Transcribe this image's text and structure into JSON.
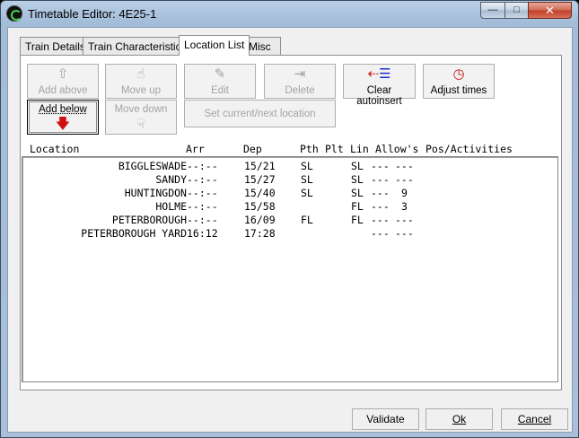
{
  "window": {
    "title": "Timetable Editor: 4E25-1",
    "minimize_glyph": "—",
    "maximize_glyph": "□",
    "close_glyph": "✕"
  },
  "tabs": [
    {
      "label": "Train Details",
      "active": false
    },
    {
      "label": "Train Characteristics",
      "active": false
    },
    {
      "label": "Location List",
      "active": true
    },
    {
      "label": "Misc",
      "active": false
    }
  ],
  "toolbar": {
    "add_above": {
      "label": "Add above",
      "icon": "arrow-up-outline-icon",
      "enabled": false
    },
    "move_up": {
      "label": "Move up",
      "icon": "hand-pointing-up-icon",
      "enabled": false
    },
    "edit": {
      "label": "Edit",
      "icon": "edit-document-icon",
      "enabled": false
    },
    "delete": {
      "label": "Delete",
      "icon": "delete-list-icon",
      "enabled": false
    },
    "clear_autoinsert": {
      "label": "Clear autoinsert",
      "icon": "clear-autoinsert-icon",
      "enabled": true
    },
    "adjust_times": {
      "label": "Adjust times",
      "icon": "clock-icon",
      "enabled": true
    },
    "add_below": {
      "label": "Add below",
      "icon": "arrow-down-red-icon",
      "enabled": true
    },
    "move_down": {
      "label": "Move down",
      "icon": "hand-pointing-down-icon",
      "enabled": false
    },
    "set_current": {
      "label": "Set current/next location",
      "enabled": false
    }
  },
  "columns": {
    "location": "Location",
    "arr": "Arr",
    "dep": "Dep",
    "pth": "Pth",
    "plt": "Plt",
    "lin": "Lin",
    "allows": "Allow's",
    "pos": "Pos/Activities"
  },
  "rows": [
    {
      "location": "BIGGLESWADE",
      "arr": "--:--",
      "dep": "15/21",
      "pth": "SL",
      "plt": "",
      "lin": "SL",
      "allow": "---",
      "pos": "---"
    },
    {
      "location": "SANDY",
      "arr": "--:--",
      "dep": "15/27",
      "pth": "SL",
      "plt": "",
      "lin": "SL",
      "allow": "---",
      "pos": "---"
    },
    {
      "location": "HUNTINGDON",
      "arr": "--:--",
      "dep": "15/40",
      "pth": "SL",
      "plt": "",
      "lin": "SL",
      "allow": "---",
      "pos": "9"
    },
    {
      "location": "HOLME",
      "arr": "--:--",
      "dep": "15/58",
      "pth": "",
      "plt": "",
      "lin": "FL",
      "allow": "---",
      "pos": "3"
    },
    {
      "location": "PETERBOROUGH",
      "arr": "--:--",
      "dep": "16/09",
      "pth": "FL",
      "plt": "",
      "lin": "FL",
      "allow": "---",
      "pos": "---"
    },
    {
      "location": "PETERBOROUGH YARD",
      "arr": "16:12",
      "dep": "17:28",
      "pth": "",
      "plt": "",
      "lin": "",
      "allow": "---",
      "pos": "---"
    }
  ],
  "footer": {
    "validate": "Validate",
    "ok": "Ok",
    "cancel": "Cancel"
  }
}
